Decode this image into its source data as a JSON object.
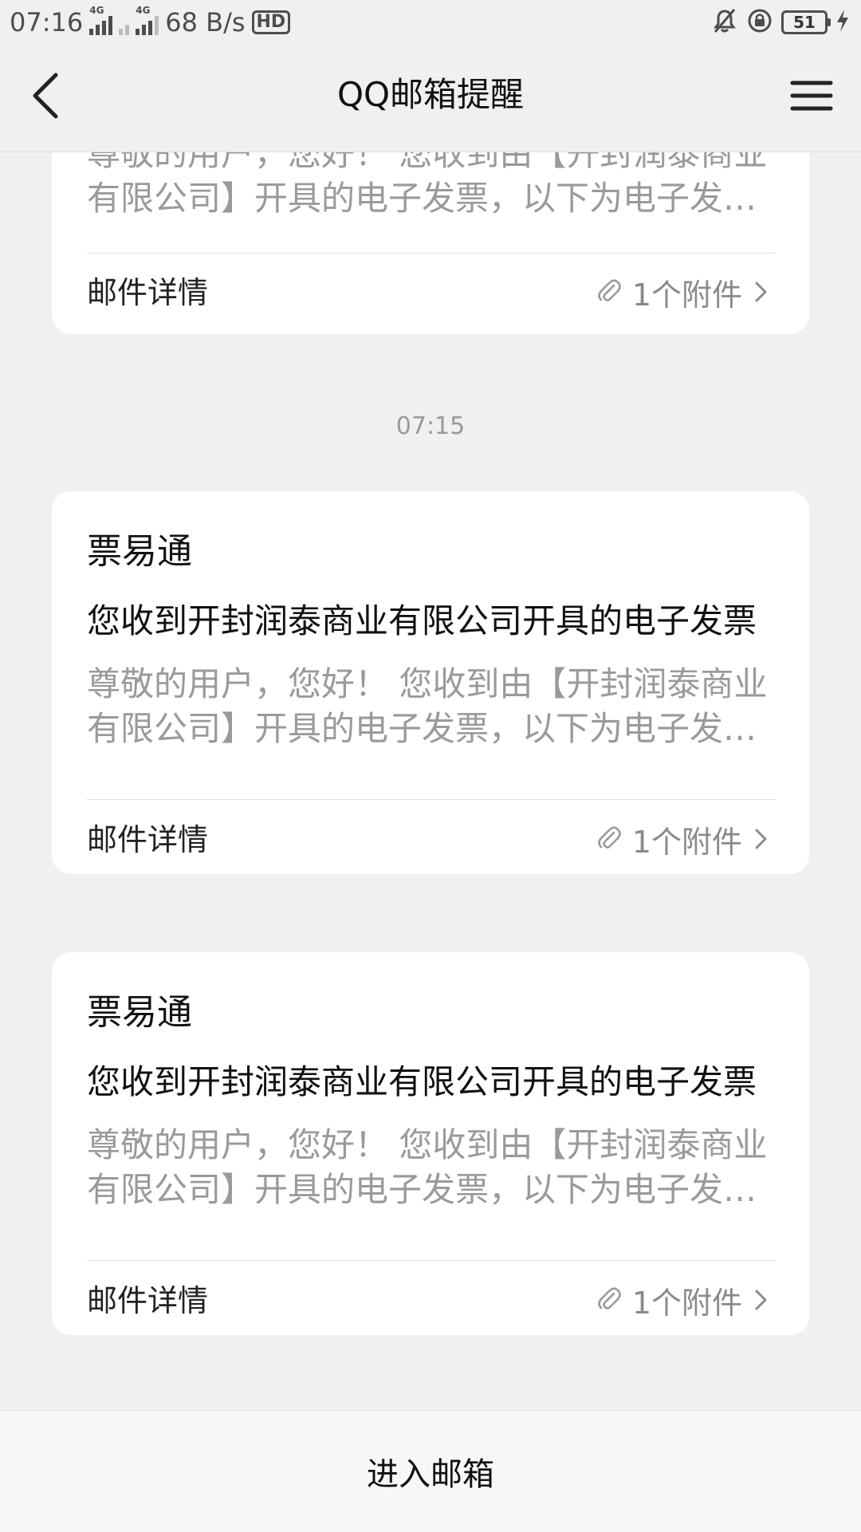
{
  "status_bar": {
    "time": "07:16",
    "signal1_tag": "4G",
    "signal2_tag": "4G",
    "network_speed": "68 B/s",
    "hd_label": "HD",
    "battery_level": "51"
  },
  "header": {
    "title": "QQ邮箱提醒"
  },
  "top_card": {
    "preview": "尊敬的用户，您好！ 您收到由【开封润泰商业有限公司】开具的电子发票，以下为电子发票详情",
    "detail_label": "邮件详情",
    "attachment_label": "1个附件"
  },
  "timestamp": "07:15",
  "cards": [
    {
      "sender": "票易通",
      "subject": "您收到开封润泰商业有限公司开具的电子发票",
      "preview": "尊敬的用户，您好！ 您收到由【开封润泰商业有限公司】开具的电子发票，以下为电子发票详情",
      "detail_label": "邮件详情",
      "attachment_label": "1个附件"
    },
    {
      "sender": "票易通",
      "subject": "您收到开封润泰商业有限公司开具的电子发票",
      "preview": "尊敬的用户，您好！ 您收到由【开封润泰商业有限公司】开具的电子发票，以下为电子发票详情",
      "detail_label": "邮件详情",
      "attachment_label": "1个附件"
    }
  ],
  "footer": {
    "enter_mailbox": "进入邮箱"
  },
  "icons": {
    "back": "chevron-left-icon",
    "menu": "hamburger-menu-icon",
    "attachment": "paperclip-icon",
    "chevron": "chevron-right-icon",
    "mute": "bell-off-icon",
    "rotation_lock": "rotation-lock-icon",
    "charging": "lightning-icon"
  }
}
